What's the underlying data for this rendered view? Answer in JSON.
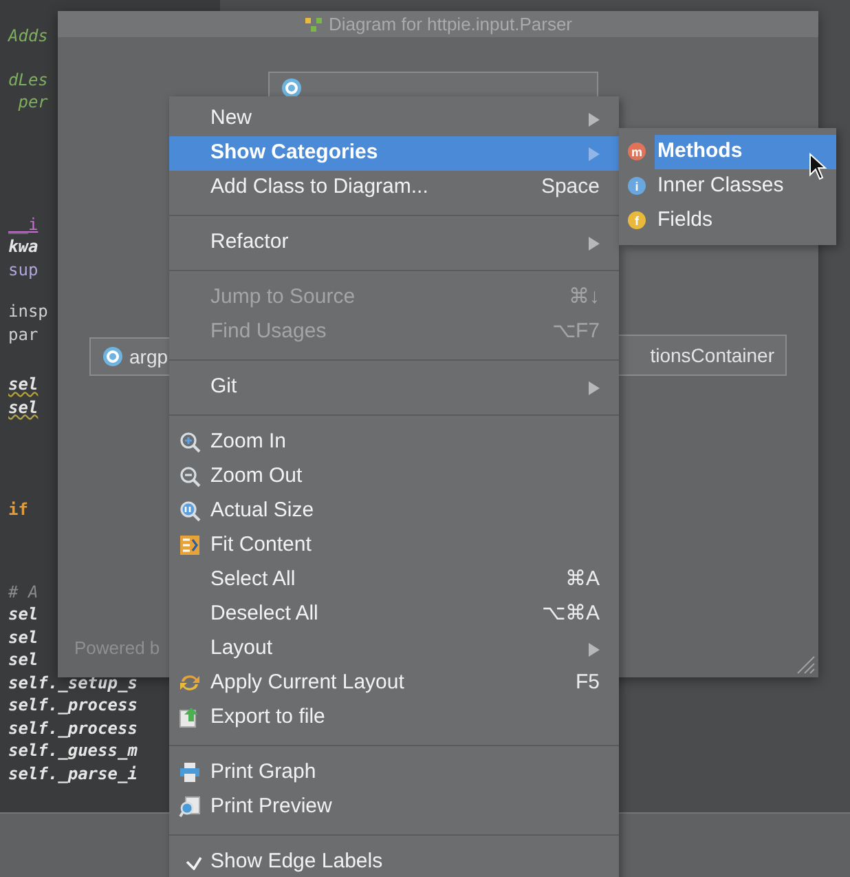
{
  "code_blocks": [
    {
      "lines": [
        {
          "text": "Adds",
          "kind": "comment"
        }
      ]
    },
    {
      "lines": [
        {
          "text": "dLes",
          "kind": "comment"
        },
        {
          "text": " per",
          "kind": "comment"
        }
      ]
    },
    {
      "lines": [
        {
          "text": "__i",
          "kind": "dunder"
        },
        {
          "text": "kwa",
          "kind": "param"
        },
        {
          "text": "sup",
          "kind": "builtin"
        }
      ]
    },
    {
      "lines": [
        {
          "text": "insp",
          "kind": "plain"
        },
        {
          "text": "par",
          "kind": "plain"
        }
      ]
    },
    {
      "lines": [
        {
          "text": "sel",
          "kind": "warn"
        },
        {
          "text": "sel",
          "kind": "warn"
        }
      ]
    },
    {
      "lines": [
        {
          "text": "if",
          "kind": "keyword"
        }
      ]
    },
    {
      "lines": [
        {
          "text": "# A",
          "kind": "hash"
        },
        {
          "text": "sel",
          "kind": "self"
        },
        {
          "text": "sel",
          "kind": "self"
        },
        {
          "text": "sel",
          "kind": "self"
        },
        {
          "text": "self._setup_s",
          "kind": "self"
        },
        {
          "text": "self._process",
          "kind": "self"
        },
        {
          "text": "self._process",
          "kind": "self"
        },
        {
          "text": "self._guess_m",
          "kind": "self"
        },
        {
          "text": "self._parse_i",
          "kind": "self"
        }
      ]
    }
  ],
  "diagram": {
    "title": "Diagram for httpie.input.Parser",
    "nodes": [
      {
        "kind": "class"
      },
      {
        "kind": "class",
        "label": "argp"
      },
      {
        "kind": "cut",
        "label": "tionsContainer"
      }
    ],
    "footer": "Powered b"
  },
  "context_menu": {
    "groups": [
      {
        "items": [
          {
            "label": "New",
            "kind": "text",
            "has_submenu": true,
            "disabled": false,
            "selected": false,
            "checked": false
          },
          {
            "label": "Show Categories",
            "kind": "text",
            "has_submenu": true,
            "disabled": false,
            "selected": true,
            "checked": false
          },
          {
            "label": "Add Class to Diagram...",
            "shortcut": "Space",
            "kind": "text",
            "has_submenu": false,
            "disabled": false,
            "selected": false,
            "checked": false
          }
        ]
      },
      {
        "items": [
          {
            "label": "Refactor",
            "kind": "text",
            "has_submenu": true,
            "disabled": false,
            "selected": false,
            "checked": false
          }
        ]
      },
      {
        "items": [
          {
            "label": "Jump to Source",
            "shortcut": "⌘↓",
            "kind": "text",
            "has_submenu": false,
            "disabled": true,
            "selected": false,
            "checked": false
          },
          {
            "label": "Find Usages",
            "shortcut": "⌥F7",
            "kind": "text",
            "has_submenu": false,
            "disabled": true,
            "selected": false,
            "checked": false
          }
        ]
      },
      {
        "items": [
          {
            "label": "Git",
            "kind": "text",
            "has_submenu": true,
            "disabled": false,
            "selected": false,
            "checked": false
          }
        ]
      },
      {
        "items": [
          {
            "label": "Zoom In",
            "kind": "zoomin",
            "has_submenu": false,
            "disabled": false,
            "selected": false,
            "checked": false
          },
          {
            "label": "Zoom Out",
            "kind": "zoomout",
            "has_submenu": false,
            "disabled": false,
            "selected": false,
            "checked": false
          },
          {
            "label": "Actual Size",
            "kind": "actualsize",
            "has_submenu": false,
            "disabled": false,
            "selected": false,
            "checked": false
          },
          {
            "label": "Fit Content",
            "kind": "fit",
            "has_submenu": false,
            "disabled": false,
            "selected": false,
            "checked": false
          },
          {
            "label": "Select All",
            "shortcut": "⌘A",
            "kind": "text",
            "has_submenu": false,
            "disabled": false,
            "selected": false,
            "checked": false
          },
          {
            "label": "Deselect All",
            "shortcut": "⌥⌘A",
            "kind": "text",
            "has_submenu": false,
            "disabled": false,
            "selected": false,
            "checked": false
          },
          {
            "label": "Layout",
            "kind": "text",
            "has_submenu": true,
            "disabled": false,
            "selected": false,
            "checked": false
          },
          {
            "label": "Apply Current Layout",
            "shortcut": "F5",
            "kind": "layout",
            "has_submenu": false,
            "disabled": false,
            "selected": false,
            "checked": false
          },
          {
            "label": "Export to file",
            "kind": "export",
            "has_submenu": false,
            "disabled": false,
            "selected": false,
            "checked": false
          }
        ]
      },
      {
        "items": [
          {
            "label": "Print Graph",
            "kind": "print",
            "has_submenu": false,
            "disabled": false,
            "selected": false,
            "checked": false
          },
          {
            "label": "Print Preview",
            "kind": "preview",
            "has_submenu": false,
            "disabled": false,
            "selected": false,
            "checked": false
          }
        ]
      },
      {
        "items": [
          {
            "label": "Show Edge Labels",
            "kind": "text",
            "has_submenu": false,
            "disabled": false,
            "selected": false,
            "checked": true
          }
        ]
      }
    ]
  },
  "submenu": {
    "items": [
      {
        "label": "Methods",
        "badge": "m",
        "color": "#e0735a",
        "selected": true
      },
      {
        "label": "Inner Classes",
        "badge": "i",
        "color": "#6aa7e0",
        "selected": false
      },
      {
        "label": "Fields",
        "badge": "f",
        "color": "#e8b93a",
        "selected": false
      }
    ]
  }
}
